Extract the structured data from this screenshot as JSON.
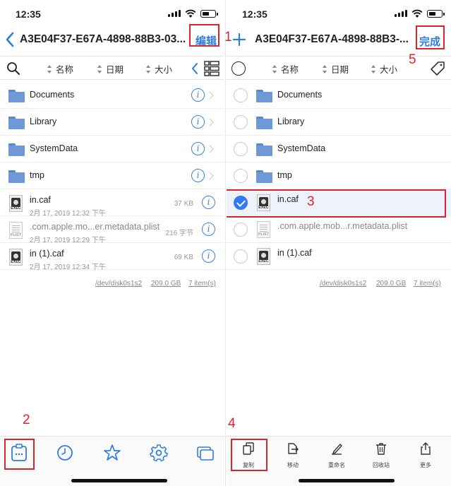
{
  "left": {
    "status": {
      "time": "12:35"
    },
    "nav": {
      "title": "A3E04F37-E67A-4898-88B3-03...",
      "edit_label": "编辑"
    },
    "sort": {
      "name": "名称",
      "date": "日期",
      "size": "大小"
    },
    "rows": [
      {
        "name": "Documents"
      },
      {
        "name": "Library"
      },
      {
        "name": "SystemData"
      },
      {
        "name": "tmp"
      },
      {
        "name": "in.caf",
        "date": "2月 17, 2019 12:32 下午",
        "size": "37 KB"
      },
      {
        "name": ".com.apple.mo...er.metadata.plist",
        "date": "2月 17, 2019 12:29 下午",
        "size": "216 字节"
      },
      {
        "name": "in (1).caf",
        "date": "2月 17, 2019 12:34 下午",
        "size": "69 KB"
      }
    ],
    "footer": {
      "disk": "/dev/disk0s1s2",
      "capacity": "209.0 GB",
      "items": "7 item(s)"
    },
    "tabs": [
      "files-icon",
      "clock-icon",
      "star-icon",
      "gear-icon",
      "windows-icon"
    ]
  },
  "right": {
    "status": {
      "time": "12:35"
    },
    "nav": {
      "title": "A3E04F37-E67A-4898-88B3-...",
      "done_label": "完成"
    },
    "sort": {
      "name": "名称",
      "date": "日期",
      "size": "大小"
    },
    "rows": [
      {
        "name": "Documents",
        "selected": false
      },
      {
        "name": "Library",
        "selected": false
      },
      {
        "name": "SystemData",
        "selected": false
      },
      {
        "name": "tmp",
        "selected": false
      },
      {
        "name": "in.caf",
        "selected": true
      },
      {
        "name": ".com.apple.mob...r.metadata.plist",
        "selected": false
      },
      {
        "name": "in (1).caf",
        "selected": false
      }
    ],
    "footer": {
      "disk": "/dev/disk0s1s2",
      "capacity": "209.0 GB",
      "items": "7 item(s)"
    },
    "toolbar": {
      "copy": "复制",
      "move": "移动",
      "rename": "重命名",
      "trash": "回收站",
      "more": "更多"
    }
  },
  "annotations": {
    "n1": "1",
    "n2": "2",
    "n3": "3",
    "n4": "4",
    "n5": "5"
  },
  "colors": {
    "accent": "#2f7de0",
    "annotation": "#d9262e",
    "folder": "#6f98d6"
  }
}
